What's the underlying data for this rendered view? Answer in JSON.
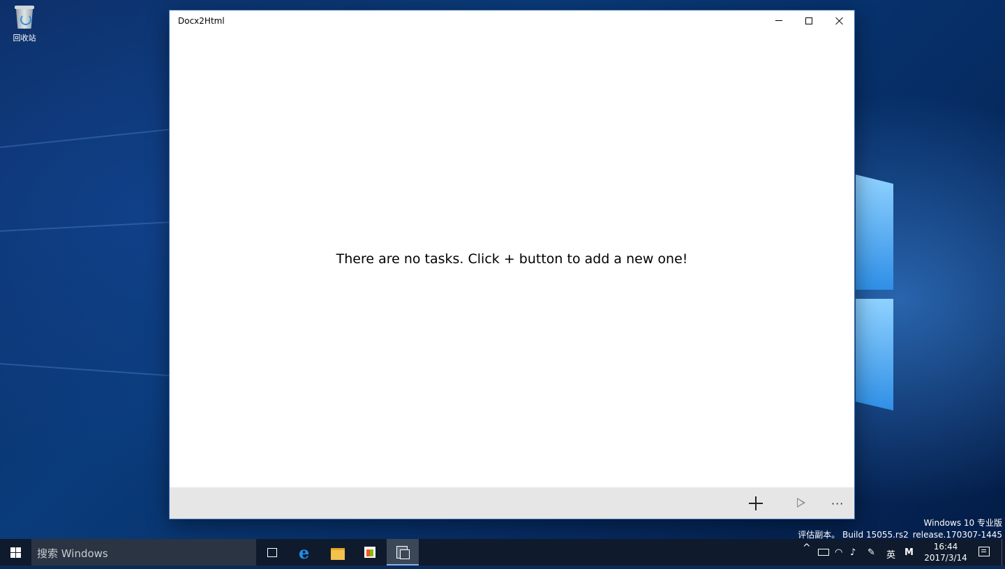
{
  "desktop": {
    "recycle_bin_label": "回收站"
  },
  "window": {
    "title": "Docx2Html",
    "controls": [
      "minimize-icon",
      "maximize-icon",
      "close-icon"
    ],
    "empty_message": "There are no tasks. Click + button to add a new one!",
    "command_bar": {
      "icons": [
        "add-icon",
        "play-icon",
        "more-icon"
      ],
      "more_label": "···"
    }
  },
  "watermark": {
    "line1": "Windows 10 专业版",
    "line2": "评估副本。 Build 15055.rs2_release.170307-1445"
  },
  "taskbar": {
    "search_placeholder": "搜索 Windows",
    "pinned": [
      "task-view-icon",
      "edge-icon",
      "file-explorer-icon",
      "store-icon",
      "docx2html-app-icon"
    ],
    "tray": {
      "chevron": "^",
      "ime_label": "英",
      "ime_mode": "M",
      "time": "16:44",
      "date": "2017/3/14"
    }
  },
  "colors": {
    "accent": "#1f8fe8",
    "taskbar": "#0f1b2c",
    "command_bar": "#e6e6e6"
  }
}
